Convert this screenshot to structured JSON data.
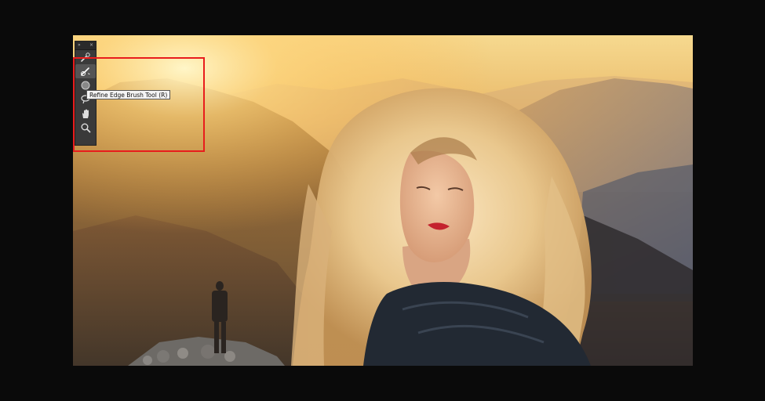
{
  "toolbox": {
    "collapse_label": "»",
    "close_label": "×",
    "tools": [
      {
        "name": "quick-selection-tool",
        "icon": "quick-selection-icon"
      },
      {
        "name": "refine-edge-brush-tool",
        "icon": "refine-edge-brush-icon",
        "active": true
      },
      {
        "name": "brush-tool",
        "icon": "brush-icon"
      },
      {
        "name": "lasso-tool",
        "icon": "lasso-icon"
      },
      {
        "name": "hand-tool",
        "icon": "hand-icon"
      },
      {
        "name": "zoom-tool",
        "icon": "zoom-icon"
      }
    ]
  },
  "tooltip": {
    "text": "Refine Edge Brush Tool (R)"
  },
  "colors": {
    "highlight": "#e81c1c",
    "panel_bg": "#3a3a3a",
    "background": "#0a0a0a"
  }
}
